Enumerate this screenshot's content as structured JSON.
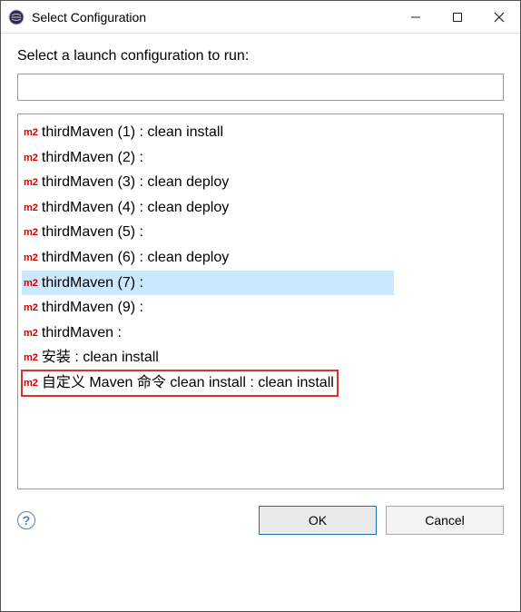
{
  "window": {
    "title": "Select Configuration"
  },
  "prompt": "Select a launch configuration to run:",
  "filter": {
    "value": "",
    "placeholder": ""
  },
  "items": [
    {
      "label": "thirdMaven (1) : clean install",
      "selected": false,
      "boxed": false
    },
    {
      "label": "thirdMaven (2) :",
      "selected": false,
      "boxed": false
    },
    {
      "label": "thirdMaven (3) : clean deploy",
      "selected": false,
      "boxed": false
    },
    {
      "label": "thirdMaven (4) : clean deploy",
      "selected": false,
      "boxed": false
    },
    {
      "label": "thirdMaven (5) :",
      "selected": false,
      "boxed": false
    },
    {
      "label": "thirdMaven (6) : clean deploy",
      "selected": false,
      "boxed": false
    },
    {
      "label": "thirdMaven (7) :",
      "selected": true,
      "boxed": false
    },
    {
      "label": "thirdMaven (9) :",
      "selected": false,
      "boxed": false
    },
    {
      "label": "thirdMaven :",
      "selected": false,
      "boxed": false
    },
    {
      "label": "安装 : clean install",
      "selected": false,
      "boxed": false
    },
    {
      "label": "自定义 Maven 命令 clean install : clean install",
      "selected": false,
      "boxed": true
    }
  ],
  "buttons": {
    "ok": "OK",
    "cancel": "Cancel"
  }
}
